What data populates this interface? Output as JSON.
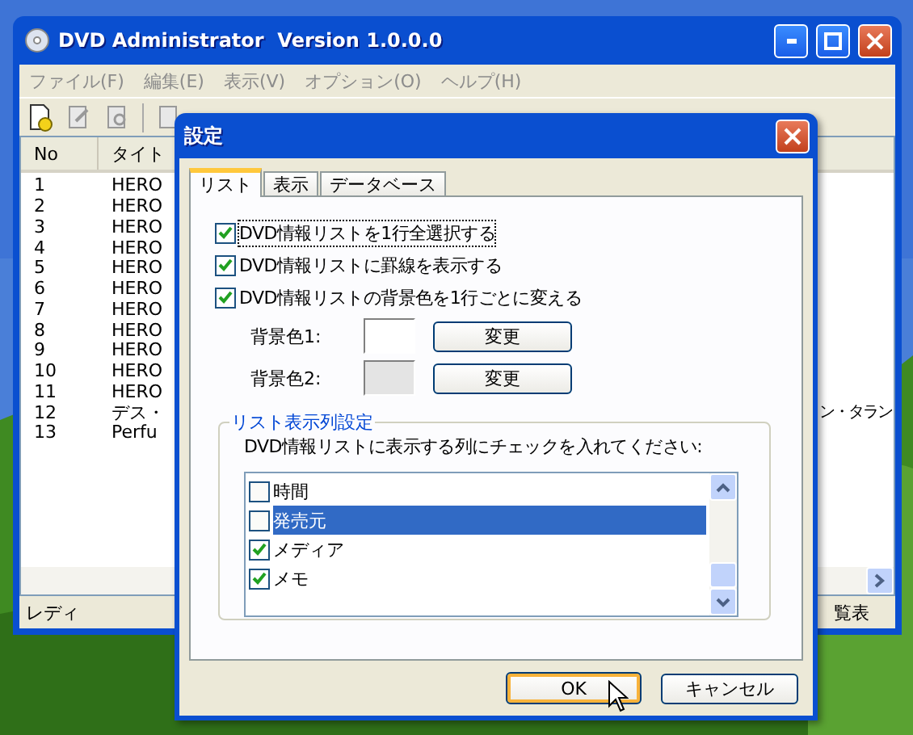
{
  "main_window": {
    "title": "DVD Administrator  Version 1.0.0.0",
    "menu": [
      "ファイル(F)",
      "編集(E)",
      "表示(V)",
      "オプション(O)",
      "ヘルプ(H)"
    ],
    "list": {
      "columns": [
        "No",
        "タイト"
      ],
      "rows": [
        {
          "no": "1",
          "title": "HERO"
        },
        {
          "no": "2",
          "title": "HERO"
        },
        {
          "no": "3",
          "title": "HERO"
        },
        {
          "no": "4",
          "title": "HERO"
        },
        {
          "no": "5",
          "title": "HERO"
        },
        {
          "no": "6",
          "title": "HERO"
        },
        {
          "no": "7",
          "title": "HERO"
        },
        {
          "no": "8",
          "title": "HERO"
        },
        {
          "no": "9",
          "title": "HERO"
        },
        {
          "no": "10",
          "title": "HERO"
        },
        {
          "no": "11",
          "title": "HERO"
        },
        {
          "no": "12",
          "title": "デス・",
          "column_3": "ン・タラン"
        },
        {
          "no": "13",
          "title": "Perfu"
        }
      ]
    },
    "status_bar": {
      "left": "レディ",
      "right": "覧表"
    }
  },
  "dialog": {
    "title": "設定",
    "tabs": [
      {
        "label": "リスト",
        "selected": true
      },
      {
        "label": "表示",
        "selected": false
      },
      {
        "label": "データベース",
        "selected": false
      }
    ],
    "options": [
      {
        "label": "DVD情報リストを1行全選択する",
        "checked": true,
        "focused": true
      },
      {
        "label": "DVD情報リストに罫線を表示する",
        "checked": true,
        "focused": false
      },
      {
        "label": "DVD情報リストの背景色を1行ごとに変える",
        "checked": true,
        "focused": false
      }
    ],
    "colors": [
      {
        "label": "背景色1:",
        "color": "#ffffff",
        "button": "変更"
      },
      {
        "label": "背景色2:",
        "color": "#e4e4e4",
        "button": "変更"
      }
    ],
    "column_group": {
      "legend": "リスト表示列設定",
      "hint": "DVD情報リストに表示する列にチェックを入れてください:",
      "items": [
        {
          "label": "時間",
          "checked": false,
          "selected": false
        },
        {
          "label": "発売元",
          "checked": false,
          "selected": true
        },
        {
          "label": "メディア",
          "checked": true,
          "selected": false
        },
        {
          "label": "メモ",
          "checked": true,
          "selected": false
        }
      ]
    },
    "buttons": [
      {
        "label": "OK",
        "default": true
      },
      {
        "label": "キャンセル",
        "default": false
      }
    ]
  }
}
